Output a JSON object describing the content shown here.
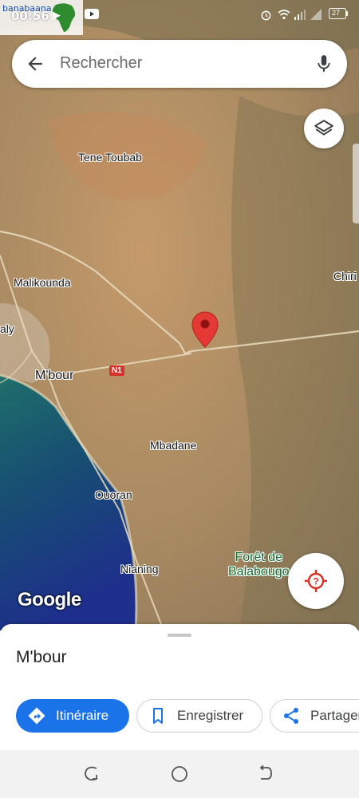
{
  "status_bar": {
    "time": "00:56",
    "battery": "27"
  },
  "watermark": {
    "text": "banabaana.com"
  },
  "search": {
    "placeholder": "Rechercher"
  },
  "map": {
    "labels": {
      "tene_toubab": "Tene Toubab",
      "malikounda": "Malikounda",
      "chiri": "Chiri",
      "aly": "aly",
      "mbour": "M'bour",
      "mbadane": "Mbadane",
      "ouoran": "Ouoran",
      "nianing": "Nianing",
      "foret_line1": "Forêt de",
      "foret_line2": "Balabougo"
    },
    "road_badge": "N1",
    "attribution": "Google",
    "pin_color": "#e53935"
  },
  "sheet": {
    "place_name": "M'bour",
    "actions": {
      "directions": "Itinéraire",
      "save": "Enregistrer",
      "share": "Partager"
    }
  },
  "colors": {
    "accent": "#1a73e8",
    "locate_red": "#d93025"
  }
}
